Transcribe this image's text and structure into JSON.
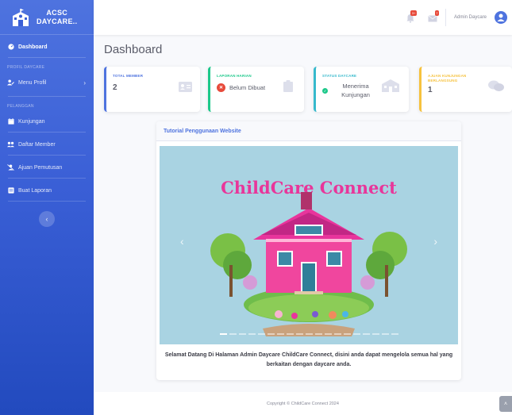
{
  "sidebar": {
    "brand_line1": "ACSC",
    "brand_line2": "DAYCARE..",
    "dashboard": "Dashboard",
    "heading_profil": "PROFIL DAYCARE",
    "menu_profil": "Menu Profil",
    "heading_pelanggan": "PELANGGAN",
    "kunjungan": "Kunjungan",
    "daftar_member": "Daftar Member",
    "ajuan_pemutusan": "Ajuan Pemutusan",
    "buat_laporan": "Buat Laporan"
  },
  "topbar": {
    "alerts_count": "3+",
    "messages_count": "7",
    "username": "Admin Daycare"
  },
  "page": {
    "title": "Dashboard"
  },
  "cards": {
    "total_member_label": "TOTAL MEMBER",
    "total_member_value": "2",
    "laporan_label": "LAPORAN HARIAN",
    "laporan_value": "Belum Dibuat",
    "status_label": "STATUS DAYCARE",
    "status_value": "Menerima Kunjungan",
    "ajuan_label": "AJUAN KUNJUNGAN BERLANGSUNG",
    "ajuan_value": "1"
  },
  "tutorial": {
    "header": "Tutorial Penggunaan Website",
    "slide_title": "ChildCare Connect",
    "welcome_text": "Selamat Datang Di Halaman Admin Daycare ChildCare Connect, disini anda dapat mengelola semua hal yang berkaitan dengan daycare anda."
  },
  "footer": {
    "copyright": "Copyright © ChildCare Connect 2024"
  },
  "colors": {
    "primary": "#4e73df",
    "success": "#1cc88a",
    "info": "#36b9cc",
    "warning": "#f6c23e",
    "danger": "#e74a3b"
  }
}
